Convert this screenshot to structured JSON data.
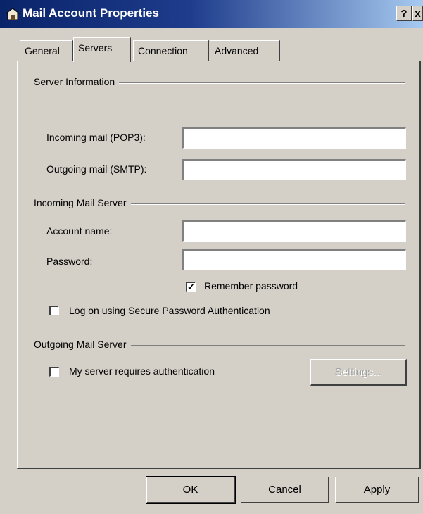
{
  "window": {
    "title": "Mail Account Properties",
    "help_button": "?",
    "close_button": "x"
  },
  "tabs": [
    {
      "label": "General",
      "active": false
    },
    {
      "label": "Servers",
      "active": true
    },
    {
      "label": "Connection",
      "active": false
    },
    {
      "label": "Advanced",
      "active": false
    }
  ],
  "server_info": {
    "group_label": "Server Information",
    "incoming_label": "Incoming mail (POP3):",
    "incoming_value": "",
    "outgoing_label": "Outgoing mail (SMTP):",
    "outgoing_value": ""
  },
  "incoming_server": {
    "group_label": "Incoming Mail Server",
    "account_label": "Account name:",
    "account_value": "",
    "password_label": "Password:",
    "password_value": "",
    "remember_label": "Remember password",
    "remember_checked": true,
    "spa_label": "Log on using Secure Password Authentication",
    "spa_checked": false
  },
  "outgoing_server": {
    "group_label": "Outgoing Mail Server",
    "auth_label": "My server requires authentication",
    "auth_checked": false,
    "settings_button": "Settings..."
  },
  "footer": {
    "ok_label": "OK",
    "cancel_label": "Cancel",
    "apply_label": "Apply"
  },
  "colors": {
    "titlebar": "#0a246a",
    "dialog_face": "#d4d0c8"
  }
}
